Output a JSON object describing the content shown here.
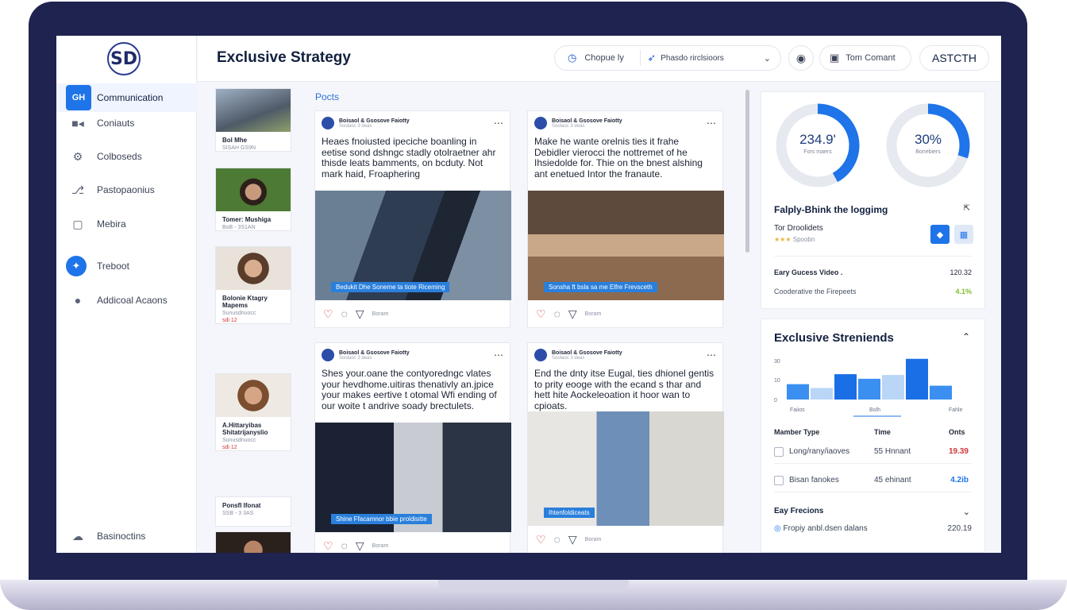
{
  "logo": "SD",
  "sidebar": {
    "items": [
      {
        "label": "Communication",
        "icon": "chat-icon",
        "badge": "GH"
      },
      {
        "label": "Coniauts",
        "icon": "video-icon"
      },
      {
        "label": "Colboseds",
        "icon": "settings-icon"
      },
      {
        "label": "Pastopaonius",
        "icon": "share-icon"
      },
      {
        "label": "Mebira",
        "icon": "square-icon"
      },
      {
        "label": "Treboot",
        "icon": "twitter-icon"
      },
      {
        "label": "Addicoal Acaons",
        "icon": "user-icon"
      }
    ],
    "bottom_item": {
      "label": "Basinoctins",
      "icon": "cloud-icon"
    }
  },
  "header": {
    "title": "Exclusive Strategy",
    "pill1_label": "Chopue ly",
    "pill1_dropdown": "Phasdo rirclsioors",
    "pill3_label": "Tom Comant",
    "pill4_label": "ASTCTH"
  },
  "thumbs": [
    {
      "t1": "Bol Mhe",
      "t2": "SISAH GS9N"
    },
    {
      "t1": "Tomer: Mushiga",
      "t2": "BoB - 3S1AN"
    },
    {
      "t1": "Bolonie Ktagry Mapems",
      "t2": "Sunusdnuocc",
      "t3": "sdi 12"
    },
    {
      "t1": "A.Hittaryibas Shitatrijanyslio",
      "t2": "Sunusdnuocc",
      "t3": "sdi 12"
    },
    {
      "t1": "Ponsfl Ifonat",
      "t2": "SSB - 3 3AS"
    }
  ],
  "posts_label": "Pocts",
  "posts": [
    {
      "author": "Boisaol & Gsosove Faiotty",
      "sub": "Soolaoc 3 deas",
      "text": "Heaes fnoiusted ipeciche boanling in eetise sond dshngc stadly otolraetner ahr thisde leats bamments, on bcduty. Not mark haid, Froaphering",
      "caption": "Bedukit Dhe Soneme ta tiote Riceming"
    },
    {
      "author": "Boisaol & Gsosove Faiotty",
      "sub": "Soolaoc 3 deas",
      "text": "Make he wante orelnis ties it frahe Debidler vierocci the nottremet of he Ihsiedolde for. Thie on the bnest alshing ant enetued Intor the franaute.",
      "caption": "Sonsha ft bsla sa me Elfre Frevsceth"
    },
    {
      "author": "Boisaol & Gsosove Faiotty",
      "sub": "Soolaoc 3 deas",
      "text": "Shes your.oane the contyoredngc vlates your hevdhome.uitiras thenativly an.jpice your makes eertive t otomal Wfi ending of our woite t andrive soady brectulets.",
      "caption": "Shine Ffacamnor bbie proldisitte"
    },
    {
      "author": "Boisaol & Gsosove Faiotty",
      "sub": "Soolaoc 3 deas",
      "text": "End the dnty itse Eugal, ties dhionel gentis to prity eooge with the ecand s thar and hett hite Aockeleoation it hoor wan to cpioats.",
      "caption": "Ihtenfoldiceats"
    }
  ],
  "post_action_label": "Boram",
  "stats": {
    "donut1_value": "234.9'",
    "donut1_label": "Fors maers",
    "donut1_fraction": 0.42,
    "donut2_value": "30%",
    "donut2_label": "Bonebiers",
    "donut2_fraction": 0.3,
    "insight_title": "Falply-Bhink the loggimg",
    "insight_sub": "Tor Droolidets",
    "insight_sub2": "Spoobn",
    "row1_label": "Eary Gucess Video .",
    "row1_value": "120.32",
    "row2_label": "Cooderative the Firepeets",
    "row2_value": "4.1%"
  },
  "trends": {
    "title": "Exclusive Streniends",
    "table_headers": [
      "Mamber Type",
      "Time",
      "Onts"
    ],
    "rows": [
      {
        "label": "Long/rany/iaoves",
        "time": "55 Hnnant",
        "value": "19.39"
      },
      {
        "label": "Bisan fanokes",
        "time": "45 ehinant",
        "value": "4.2ib"
      }
    ],
    "footer_title": "Eay Frecions",
    "footer_label": "Fropiy anbl.dsen dalans",
    "footer_value": "220.19"
  },
  "chart_data": {
    "type": "bar",
    "categories": [
      "Faiios",
      "",
      "",
      "Bolh",
      "",
      "Fahle"
    ],
    "series": [
      {
        "values": [
          20,
          15,
          33,
          27,
          32,
          53,
          18
        ]
      }
    ],
    "ytick_labels": [
      "30",
      "10",
      "0"
    ],
    "xtick_labels": [
      "Faiios",
      "Bolh",
      "Fahle"
    ]
  },
  "colors": {
    "accent": "#1e74e8",
    "frame": "#1f2350",
    "negative": "#d0363a",
    "positive": "#7fbf2f"
  }
}
